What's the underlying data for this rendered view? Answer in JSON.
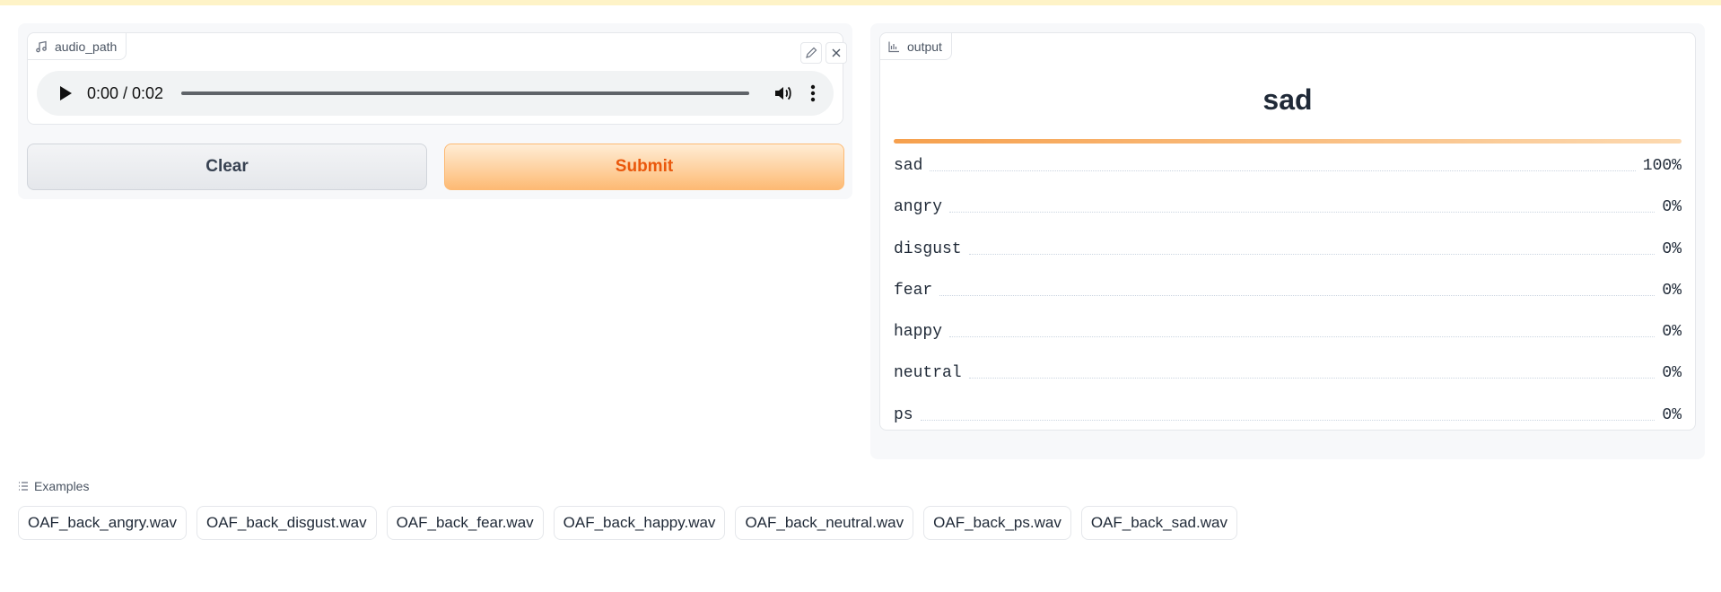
{
  "input": {
    "label": "audio_path",
    "player": {
      "time": "0:00 / 0:02",
      "progress": 0
    }
  },
  "buttons": {
    "clear": "Clear",
    "submit": "Submit"
  },
  "output": {
    "label": "output",
    "top_label": "sad",
    "confidences": [
      {
        "label": "sad",
        "value": "100%"
      },
      {
        "label": "angry",
        "value": "0%"
      },
      {
        "label": "disgust",
        "value": "0%"
      },
      {
        "label": "fear",
        "value": "0%"
      },
      {
        "label": "happy",
        "value": "0%"
      },
      {
        "label": "neutral",
        "value": "0%"
      },
      {
        "label": "ps",
        "value": "0%"
      }
    ]
  },
  "examples": {
    "title": "Examples",
    "items": [
      "OAF_back_angry.wav",
      "OAF_back_disgust.wav",
      "OAF_back_fear.wav",
      "OAF_back_happy.wav",
      "OAF_back_neutral.wav",
      "OAF_back_ps.wav",
      "OAF_back_sad.wav"
    ]
  },
  "colors": {
    "accent": "#ea580c",
    "bar": "#f6a04d"
  }
}
